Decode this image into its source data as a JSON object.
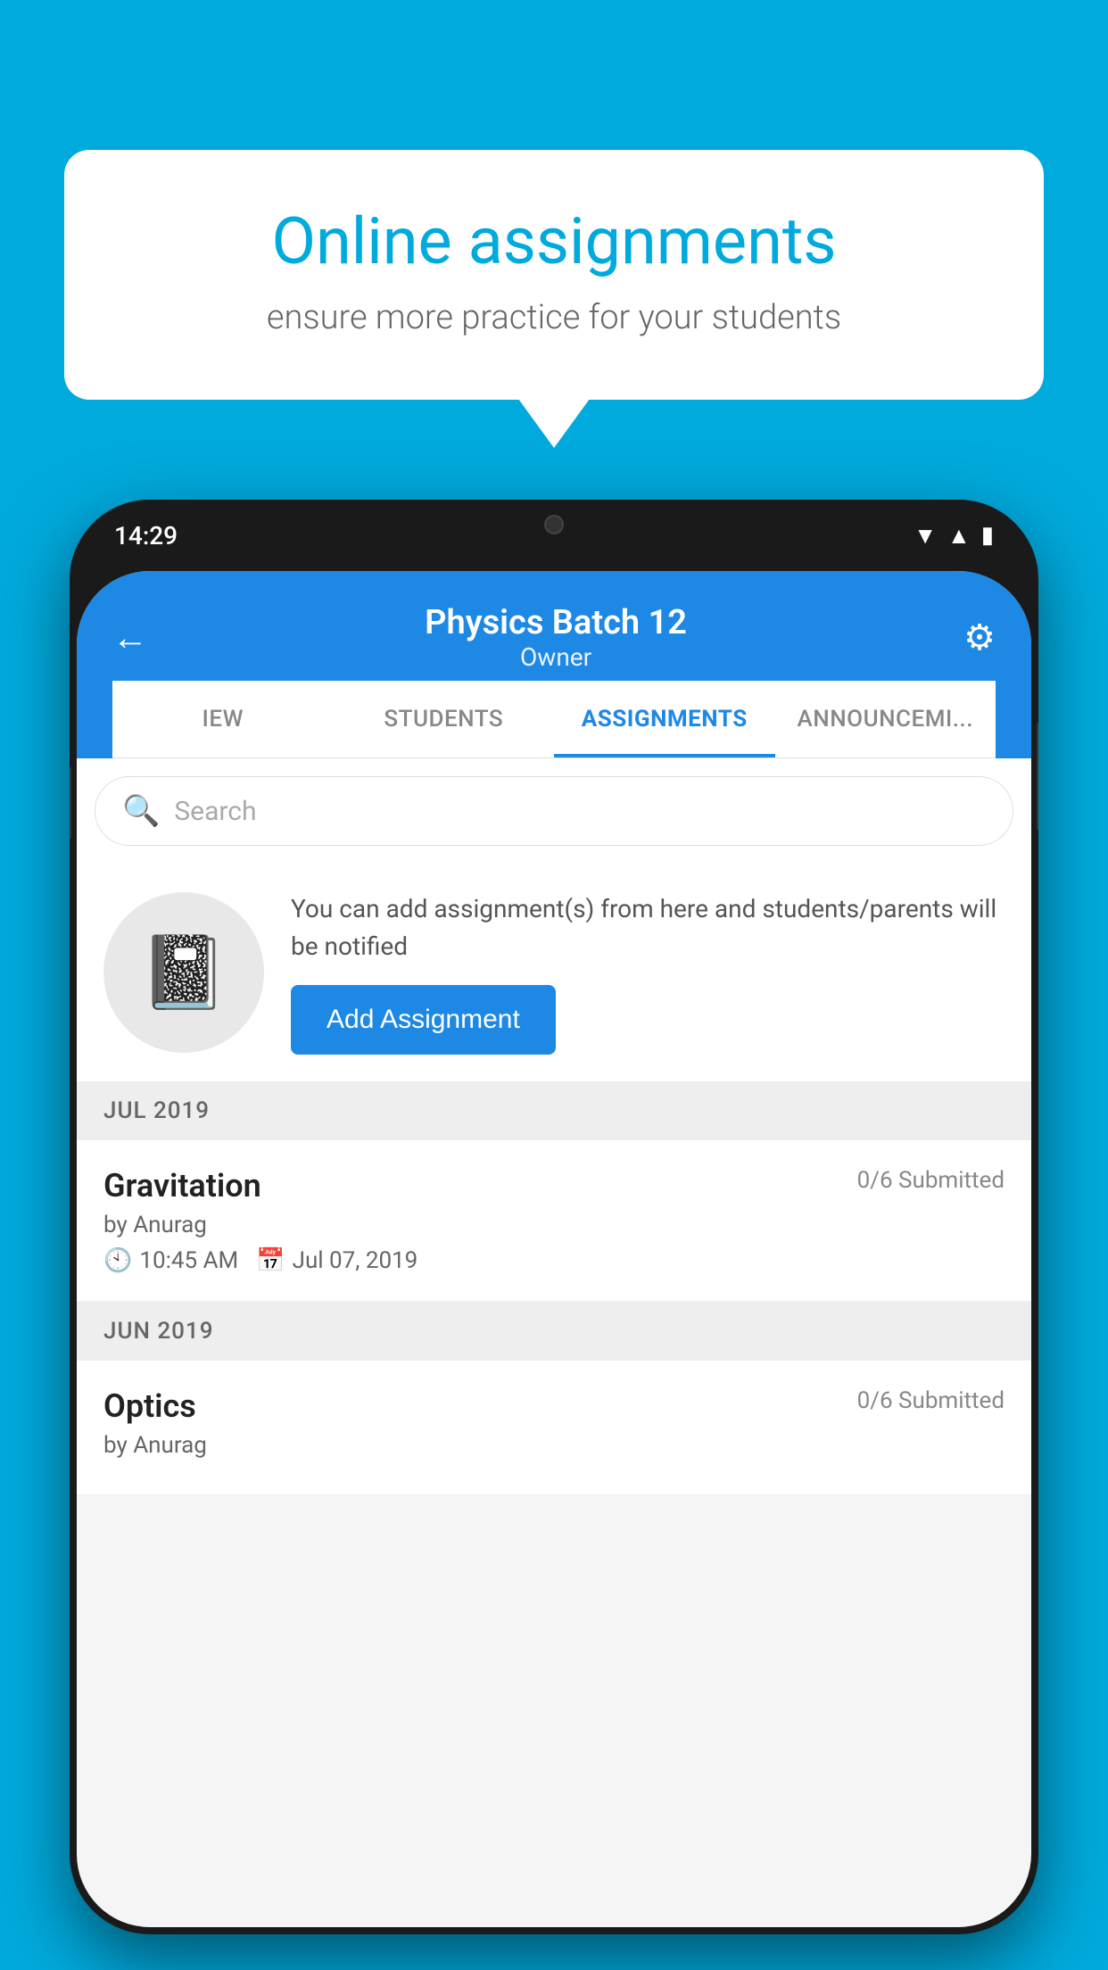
{
  "background_color": "#00AADD",
  "speech_bubble": {
    "title": "Online assignments",
    "subtitle": "ensure more practice for your students"
  },
  "phone": {
    "status_bar": {
      "time": "14:29"
    },
    "header": {
      "title": "Physics Batch 12",
      "subtitle": "Owner",
      "back_label": "←",
      "settings_label": "⚙"
    },
    "tabs": [
      {
        "label": "IEW",
        "active": false
      },
      {
        "label": "STUDENTS",
        "active": false
      },
      {
        "label": "ASSIGNMENTS",
        "active": true
      },
      {
        "label": "ANNOUNCEMENTS",
        "active": false
      }
    ],
    "search": {
      "placeholder": "Search"
    },
    "promo": {
      "description": "You can add assignment(s) from here and students/parents will be notified",
      "button_label": "Add Assignment"
    },
    "assignment_sections": [
      {
        "month": "JUL 2019",
        "assignments": [
          {
            "title": "Gravitation",
            "submitted": "0/6 Submitted",
            "author": "by Anurag",
            "time": "10:45 AM",
            "date": "Jul 07, 2019"
          }
        ]
      },
      {
        "month": "JUN 2019",
        "assignments": [
          {
            "title": "Optics",
            "submitted": "0/6 Submitted",
            "author": "by Anurag",
            "time": "",
            "date": ""
          }
        ]
      }
    ]
  }
}
